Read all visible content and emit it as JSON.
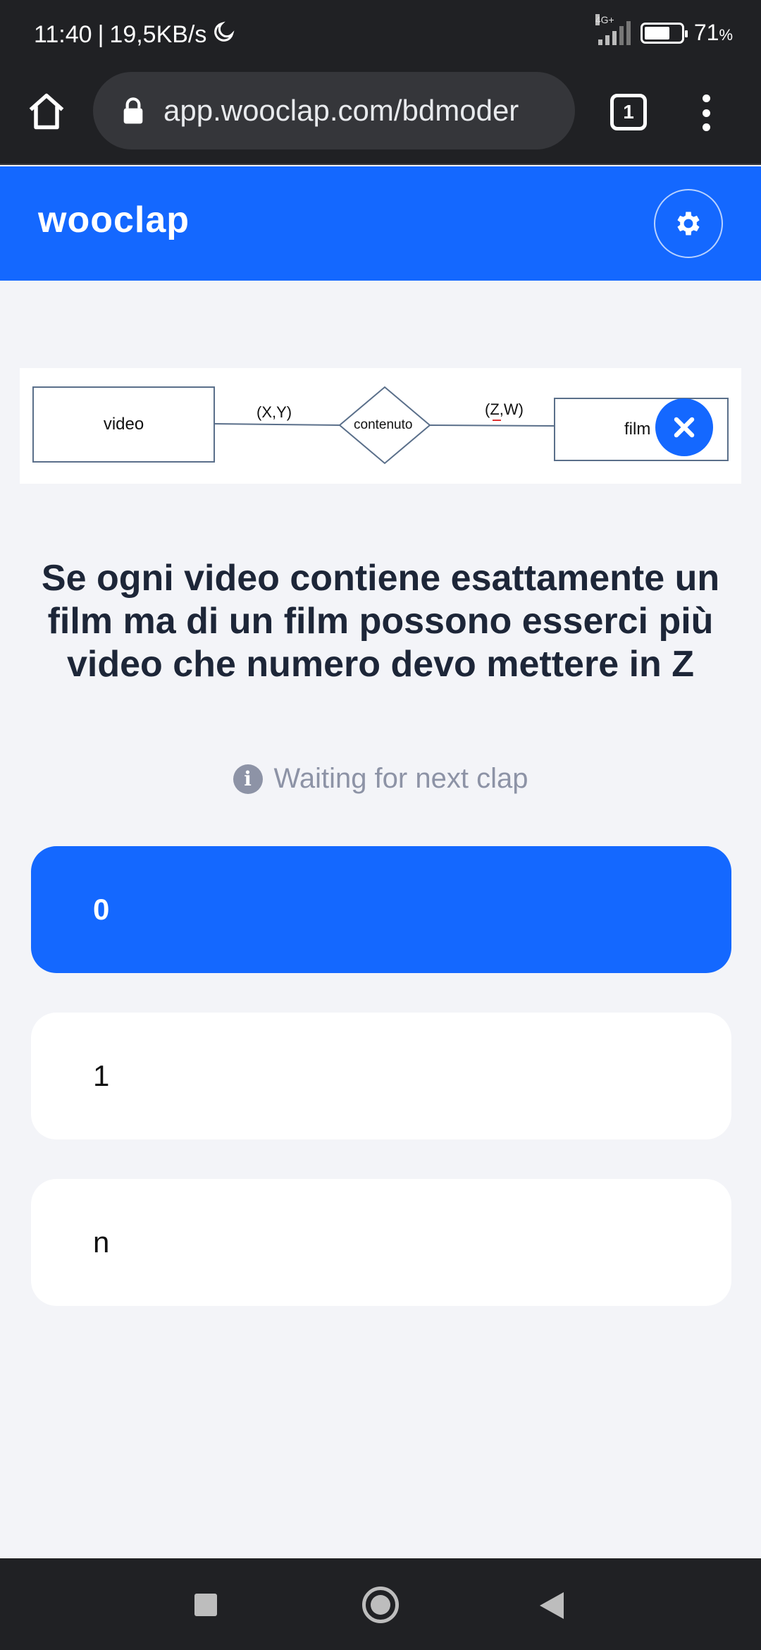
{
  "status_bar": {
    "time": "11:40",
    "separator": "|",
    "net_speed": "19,5KB/s",
    "network_type": "4G+",
    "battery_percent": "71",
    "battery_unit": "%",
    "battery_level": 0.71,
    "icons": [
      "moon-icon",
      "signal-icon",
      "battery-icon"
    ]
  },
  "browser": {
    "url": "app.wooclap.com/bdmoder",
    "tab_count": "1",
    "icons": [
      "home-icon",
      "lock-icon",
      "tabs-icon",
      "more-vert-icon"
    ]
  },
  "header": {
    "logo": "wooclap",
    "accent_color": "#1468ff",
    "icons": [
      "gear-icon"
    ]
  },
  "diagram": {
    "entity_left": "video",
    "relationship": "contenuto",
    "cardinality_left": "(X,Y)",
    "cardinality_right": "(Z,W)",
    "entity_right": "film"
  },
  "question": {
    "line1": "Se ogni video contiene esattamente un",
    "line2": "film ma di un film possono esserci più",
    "line3": "video che numero devo mettere in Z"
  },
  "status_message": "Waiting for next clap",
  "options": [
    {
      "label": "0",
      "selected": true
    },
    {
      "label": "1",
      "selected": false
    },
    {
      "label": "n",
      "selected": false
    }
  ],
  "nav": {
    "icons": [
      "recents-icon",
      "home-circle-icon",
      "back-icon"
    ]
  }
}
